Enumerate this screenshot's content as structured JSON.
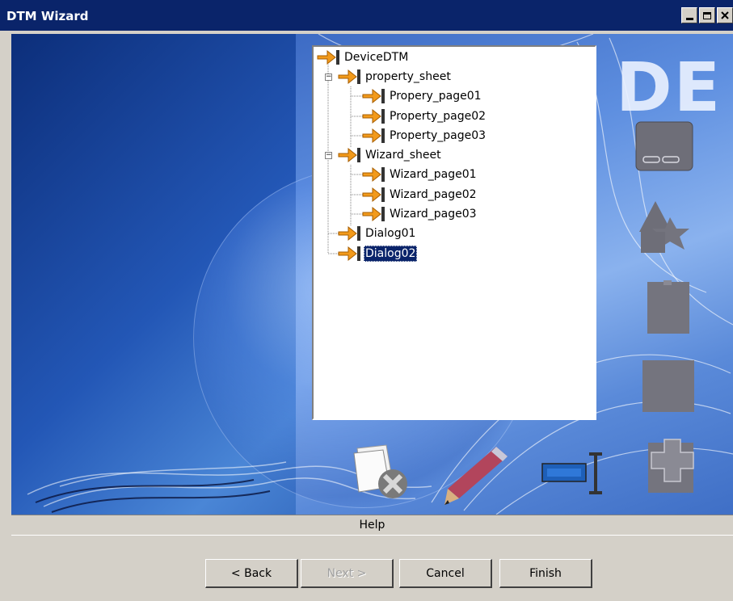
{
  "window": {
    "title": "DTM Wizard",
    "controls": {
      "minimize": "minimize",
      "maximize": "maximize",
      "close": "close"
    }
  },
  "tree": {
    "root": {
      "label": "DeviceDTM"
    },
    "nodes": [
      {
        "label": "property_sheet",
        "expander": "−"
      },
      {
        "label": "Propery_page01"
      },
      {
        "label": "Property_page02"
      },
      {
        "label": "Property_page03"
      },
      {
        "label": "Wizard_sheet",
        "expander": "−"
      },
      {
        "label": "Wizard_page01"
      },
      {
        "label": "Wizard_page02"
      },
      {
        "label": "Wizard_page03"
      },
      {
        "label": "Dialog01"
      },
      {
        "label": "Dialog02",
        "selected": true
      }
    ]
  },
  "decor": {
    "letters": "DE"
  },
  "help": {
    "label": "Help"
  },
  "buttons": {
    "back": "< Back",
    "next": "Next >",
    "cancel": "Cancel",
    "finish": "Finish"
  },
  "colors": {
    "titlebar": "#0a246a",
    "dialog_bg": "#d4d0c8",
    "tree_bg": "#ffffff",
    "selection": "#0a246a",
    "node_icon": "#f29a1b"
  }
}
